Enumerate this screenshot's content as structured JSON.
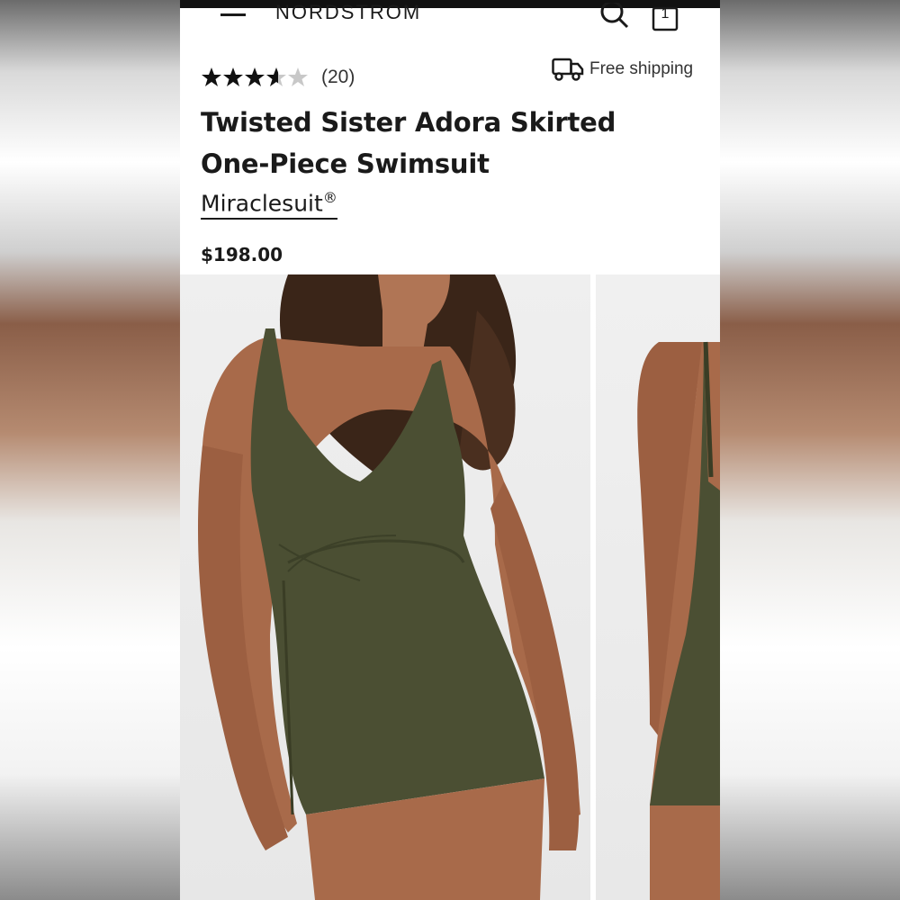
{
  "header": {
    "brand": "NORDSTROM",
    "bag_count": "1"
  },
  "product": {
    "rating": 4,
    "review_count": "(20)",
    "shipping": "Free shipping",
    "title": "Twisted Sister Adora Skirted One-Piece Swimsuit",
    "brand": "Miraclesuit",
    "brand_mark": "®",
    "price": "$198.00"
  },
  "colors": {
    "swimsuit": "#4b4f33",
    "skin": "#a86a4a",
    "hair": "#3a2518",
    "background": "#ffffff"
  },
  "icons": {
    "menu": "hamburger-icon",
    "search": "search-icon",
    "bag": "shopping-bag-icon",
    "truck": "truck-icon",
    "star": "star-icon"
  }
}
